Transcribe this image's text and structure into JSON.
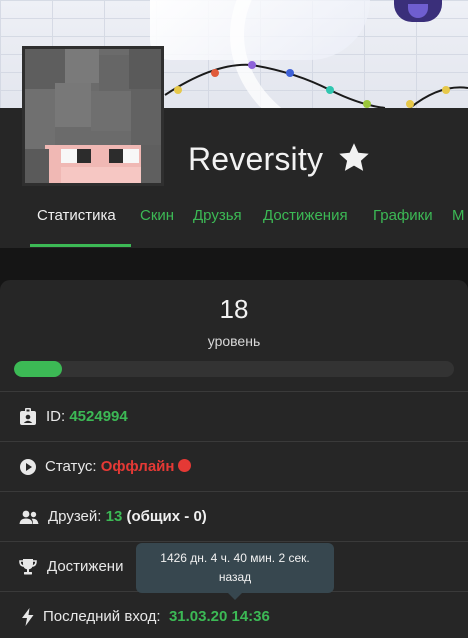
{
  "profile": {
    "username": "Reversity",
    "star_icon": "star-icon"
  },
  "tabs": [
    {
      "label": "Статистика",
      "active": true
    },
    {
      "label": "Скин",
      "active": false
    },
    {
      "label": "Друзья",
      "active": false
    },
    {
      "label": "Достижения",
      "active": false
    },
    {
      "label": "Графики",
      "active": false
    },
    {
      "label": "М",
      "active": false
    }
  ],
  "level": {
    "value": "18",
    "label": "уровень",
    "progress_fraction": 0.11
  },
  "stats": {
    "id_label": "ID:",
    "id_value": "4524994",
    "status_label": "Статус:",
    "status_value": "Оффлайн",
    "friends_label": "Друзей:",
    "friends_value": "13",
    "friends_common": "(общих - 0)",
    "achievements_label": "Достижени",
    "last_login_label": "Последний вход:",
    "last_login_value": "31.03.20 14:36"
  },
  "tooltip": {
    "line1": "1426 дн. 4 ч. 40 мин. 2 сек.",
    "line2": "назад"
  },
  "colors": {
    "accent": "#3cb955",
    "offline": "#e53935",
    "panel": "#262626",
    "background": "#151515"
  }
}
